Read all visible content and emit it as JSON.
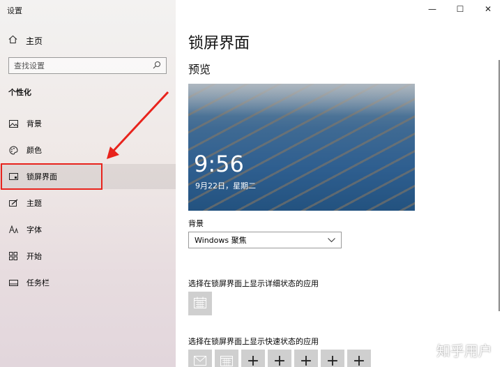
{
  "window": {
    "title": "设置"
  },
  "sidebar": {
    "home_label": "主页",
    "search_placeholder": "查找设置",
    "section_title": "个性化",
    "items": [
      {
        "label": "背景",
        "icon": "picture-icon"
      },
      {
        "label": "颜色",
        "icon": "palette-icon"
      },
      {
        "label": "锁屏界面",
        "icon": "lock-screen-icon",
        "selected": true
      },
      {
        "label": "主题",
        "icon": "theme-icon"
      },
      {
        "label": "字体",
        "icon": "font-icon"
      },
      {
        "label": "开始",
        "icon": "start-icon"
      },
      {
        "label": "任务栏",
        "icon": "taskbar-icon"
      }
    ]
  },
  "main": {
    "page_title": "锁屏界面",
    "preview_title": "预览",
    "preview_time": "9:56",
    "preview_date": "9月22日，星期二",
    "background_label": "背景",
    "background_value": "Windows 聚焦",
    "detail_status_label": "选择在锁屏界面上显示详细状态的应用",
    "quick_status_label": "选择在锁屏界面上显示快速状态的应用"
  },
  "watermark": "知乎用户",
  "colors": {
    "highlight": "#e8231c",
    "sidebar_bg": "#efe8e6",
    "tile": "#cfcfcf"
  }
}
